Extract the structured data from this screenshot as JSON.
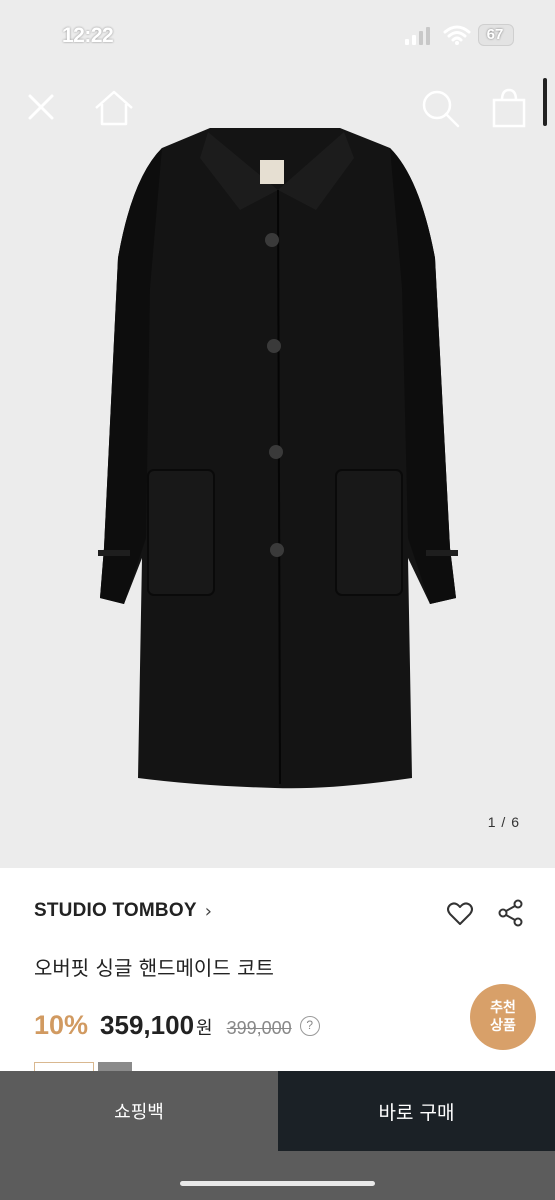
{
  "status_bar": {
    "time": "12:22",
    "battery": "67"
  },
  "nav": {
    "close": "close-icon",
    "home": "home-icon",
    "search": "search-icon",
    "bag": "shopping-bag-icon"
  },
  "gallery": {
    "counter": "1 / 6"
  },
  "product": {
    "brand": "STUDIO TOMBOY",
    "brand_chevron": "›",
    "name": "오버핏 싱글 핸드메이드 코트",
    "discount": "10%",
    "sale_price": "359,100",
    "currency": "원",
    "original_price": "399,000",
    "help": "?"
  },
  "badge": {
    "line1": "추천",
    "line2": "상품"
  },
  "actions": {
    "cart": "쇼핑백",
    "buy": "바로 구매"
  },
  "colors": {
    "accent": "#d19a61",
    "badge": "#d8a069",
    "buy_button": "#1b2126",
    "cart_button": "#5c5c5c"
  }
}
